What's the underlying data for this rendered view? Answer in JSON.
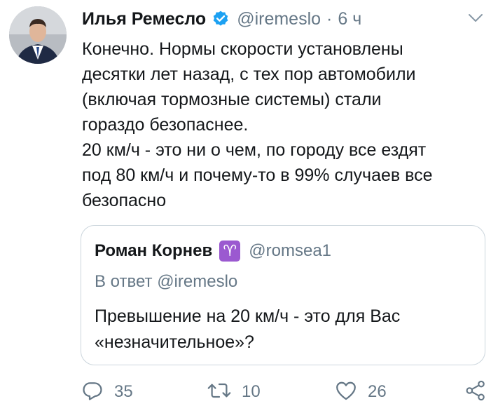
{
  "tweet": {
    "author": {
      "name": "Илья Ремесло",
      "handle": "@iremeslo",
      "verified": true
    },
    "time_separator": "·",
    "time": "6 ч",
    "text_lines": [
      "Конечно. Нормы скорости установлены",
      "десятки лет назад, с тех пор автомобили",
      "(включая тормозные системы) стали",
      "гораздо безопаснее.",
      "20 км/ч - это ни о чем, по городу все ездят",
      "под 80 км/ч и почему-то в 99% случаев все",
      "безопасно"
    ],
    "quoted": {
      "name": "Роман Корнев",
      "emoji": "♈",
      "handle": "@romsea1",
      "reply_prefix": "В ответ",
      "reply_mention": "@iremeslo",
      "text_lines": [
        "Превышение на 20 км/ч - это для Вас",
        "«незначительное»?"
      ]
    },
    "actions": {
      "replies": "35",
      "retweets": "10",
      "likes": "26"
    }
  },
  "colors": {
    "text": "#14171a",
    "secondary": "#657786",
    "verified": "#1da1f2",
    "border": "#ccd6dd",
    "aries_badge": "#9b59d0"
  },
  "icons": [
    "avatar",
    "verified-badge-icon",
    "chevron-down-icon",
    "reply-icon",
    "retweet-icon",
    "heart-icon",
    "share-icon"
  ]
}
